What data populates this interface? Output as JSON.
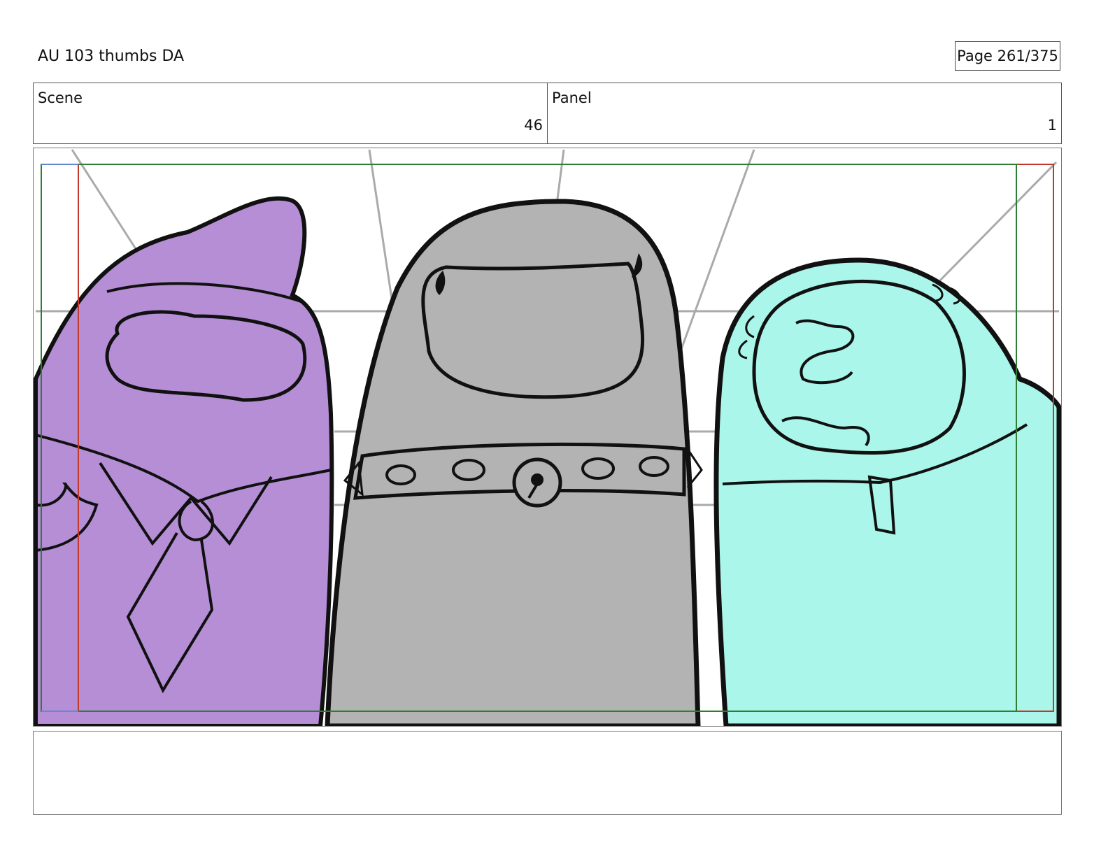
{
  "header": {
    "title": "AU 103 thumbs DA",
    "page": "Page 261/375"
  },
  "info": {
    "scene_label": "Scene",
    "scene_value": "46",
    "panel_label": "Panel",
    "panel_value": "1"
  },
  "panel": {
    "colors": {
      "left_character": "#b58ed6",
      "middle_character": "#b3b3b3",
      "right_character": "#aaf6ea",
      "outline": "#111111",
      "action_safe_frame": "#c0392b",
      "title_safe_frame": "#2e7d32",
      "perspective_lines": "#aaaaaa"
    }
  },
  "notes": {
    "text": ""
  }
}
